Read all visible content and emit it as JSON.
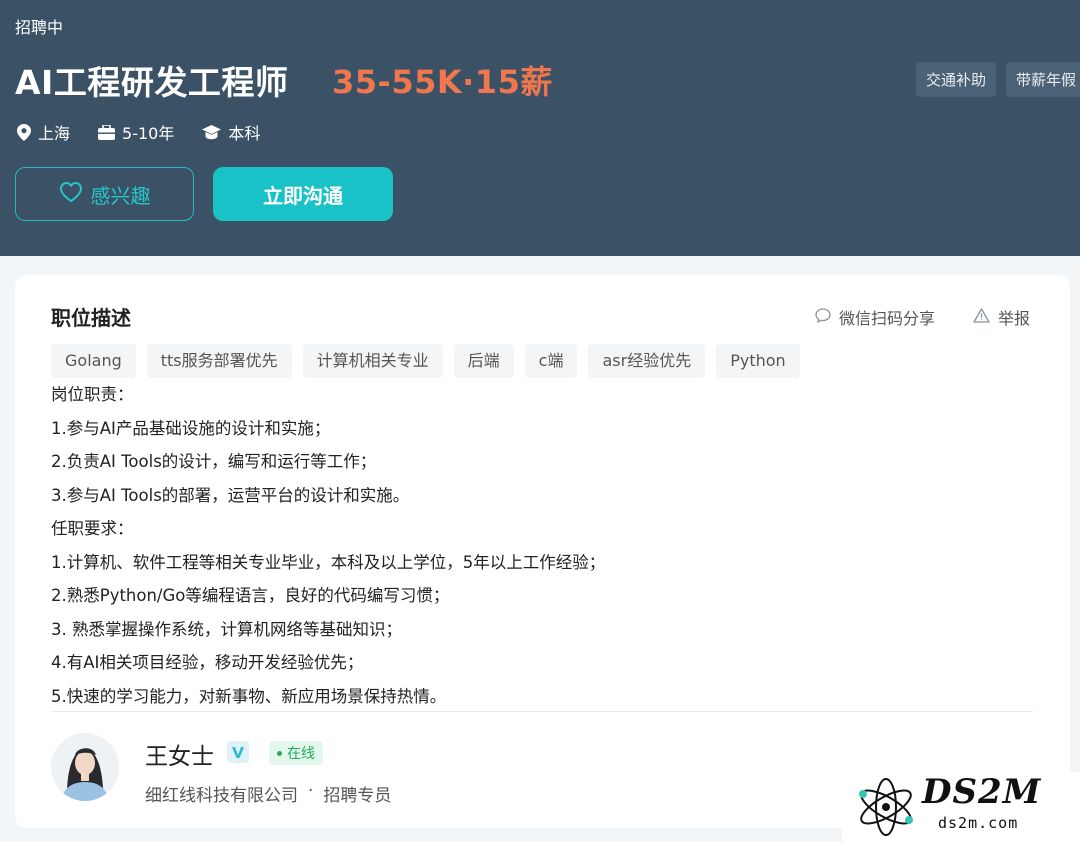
{
  "header": {
    "status": "招聘中",
    "title": "AI工程研发工程师",
    "salary": "35-55K·15薪",
    "benefits": [
      "交通补助",
      "带薪年假"
    ],
    "location": "上海",
    "experience": "5-10年",
    "education": "本科",
    "interest_label": "感兴趣",
    "chat_label": "立即沟通"
  },
  "job": {
    "section_title": "职位描述",
    "share_label": "微信扫码分享",
    "report_label": "举报",
    "tags": [
      "Golang",
      "tts服务部署优先",
      "计算机相关专业",
      "后端",
      "c端",
      "asr经验优先",
      "Python"
    ],
    "description": [
      "岗位职责：",
      "1.参与AI产品基础设施的设计和实施；",
      "2.负责AI Tools的设计，编写和运行等工作；",
      "3.参与AI Tools的部署，运营平台的设计和实施。",
      "任职要求：",
      "1.计算机、软件工程等相关专业毕业，本科及以上学位，5年以上工作经验；",
      "2.熟悉Python/Go等编程语言，良好的代码编写习惯；",
      "3. 熟悉掌握操作系统，计算机网络等基础知识；",
      "4.有AI相关项目经验，移动开发经验优先；",
      "5.快速的学习能力，对新事物、新应用场景保持热情。"
    ]
  },
  "recruiter": {
    "name": "王女士",
    "status": "在线",
    "company": "细红线科技有限公司",
    "separator": "·",
    "role": "招聘专员"
  },
  "watermark": {
    "text": "DS2M",
    "sub": "ds2m.com"
  },
  "colors": {
    "header_bg": "#3b5266",
    "salary": "#f0764e",
    "accent": "#19c2c6",
    "online": "#24a85a"
  }
}
